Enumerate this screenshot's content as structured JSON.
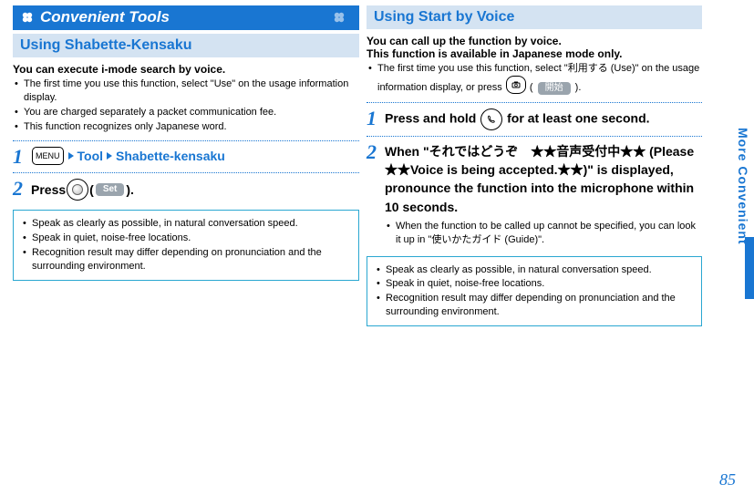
{
  "left": {
    "title": "Convenient Tools",
    "sub1": "Using Shabette-Kensaku",
    "intro1": "You can execute i-mode search by voice.",
    "bullets1": [
      "The first time you use this function, select \"Use\" on the usage information display.",
      "You are charged separately a packet communication fee.",
      "This function recognizes only Japanese word."
    ],
    "step1": {
      "menu": "MENU",
      "t1": "Tool",
      "t2": "Shabette-kensaku"
    },
    "step2": {
      "prefix": "Press",
      "tag": "Set",
      "suffix": ")."
    },
    "tips": [
      "Speak as clearly as possible, in natural conversation speed.",
      "Speak in quiet, noise-free locations.",
      "Recognition result may differ depending on pronunciation and the surrounding environment."
    ]
  },
  "right": {
    "sub1": "Using Start by Voice",
    "intro1": "You can call up the function by voice.",
    "intro2": "This function is available in Japanese mode only.",
    "bullet1a": "The first time you use this function, select \"利用する (Use)\" on the usage information display, or press ",
    "bullet1_tag": "開始",
    "bullet1b": ").",
    "step1a": "Press and hold ",
    "step1b": " for at least one second.",
    "step2": "When \"それではどうぞ　★★音声受付中★★ (Please　★★Voice is being accepted.★★)\" is displayed, pronounce the function into the microphone within 10 seconds.",
    "step2_note": "When the function to be called up cannot be specified, you can look it up in \"使いかたガイド (Guide)\".",
    "tips": [
      "Speak as clearly as possible, in natural conversation speed.",
      "Speak in quiet, noise-free locations.",
      "Recognition result may differ depending on pronunciation and the surrounding environment."
    ]
  },
  "side": "More Convenient",
  "page": "85"
}
